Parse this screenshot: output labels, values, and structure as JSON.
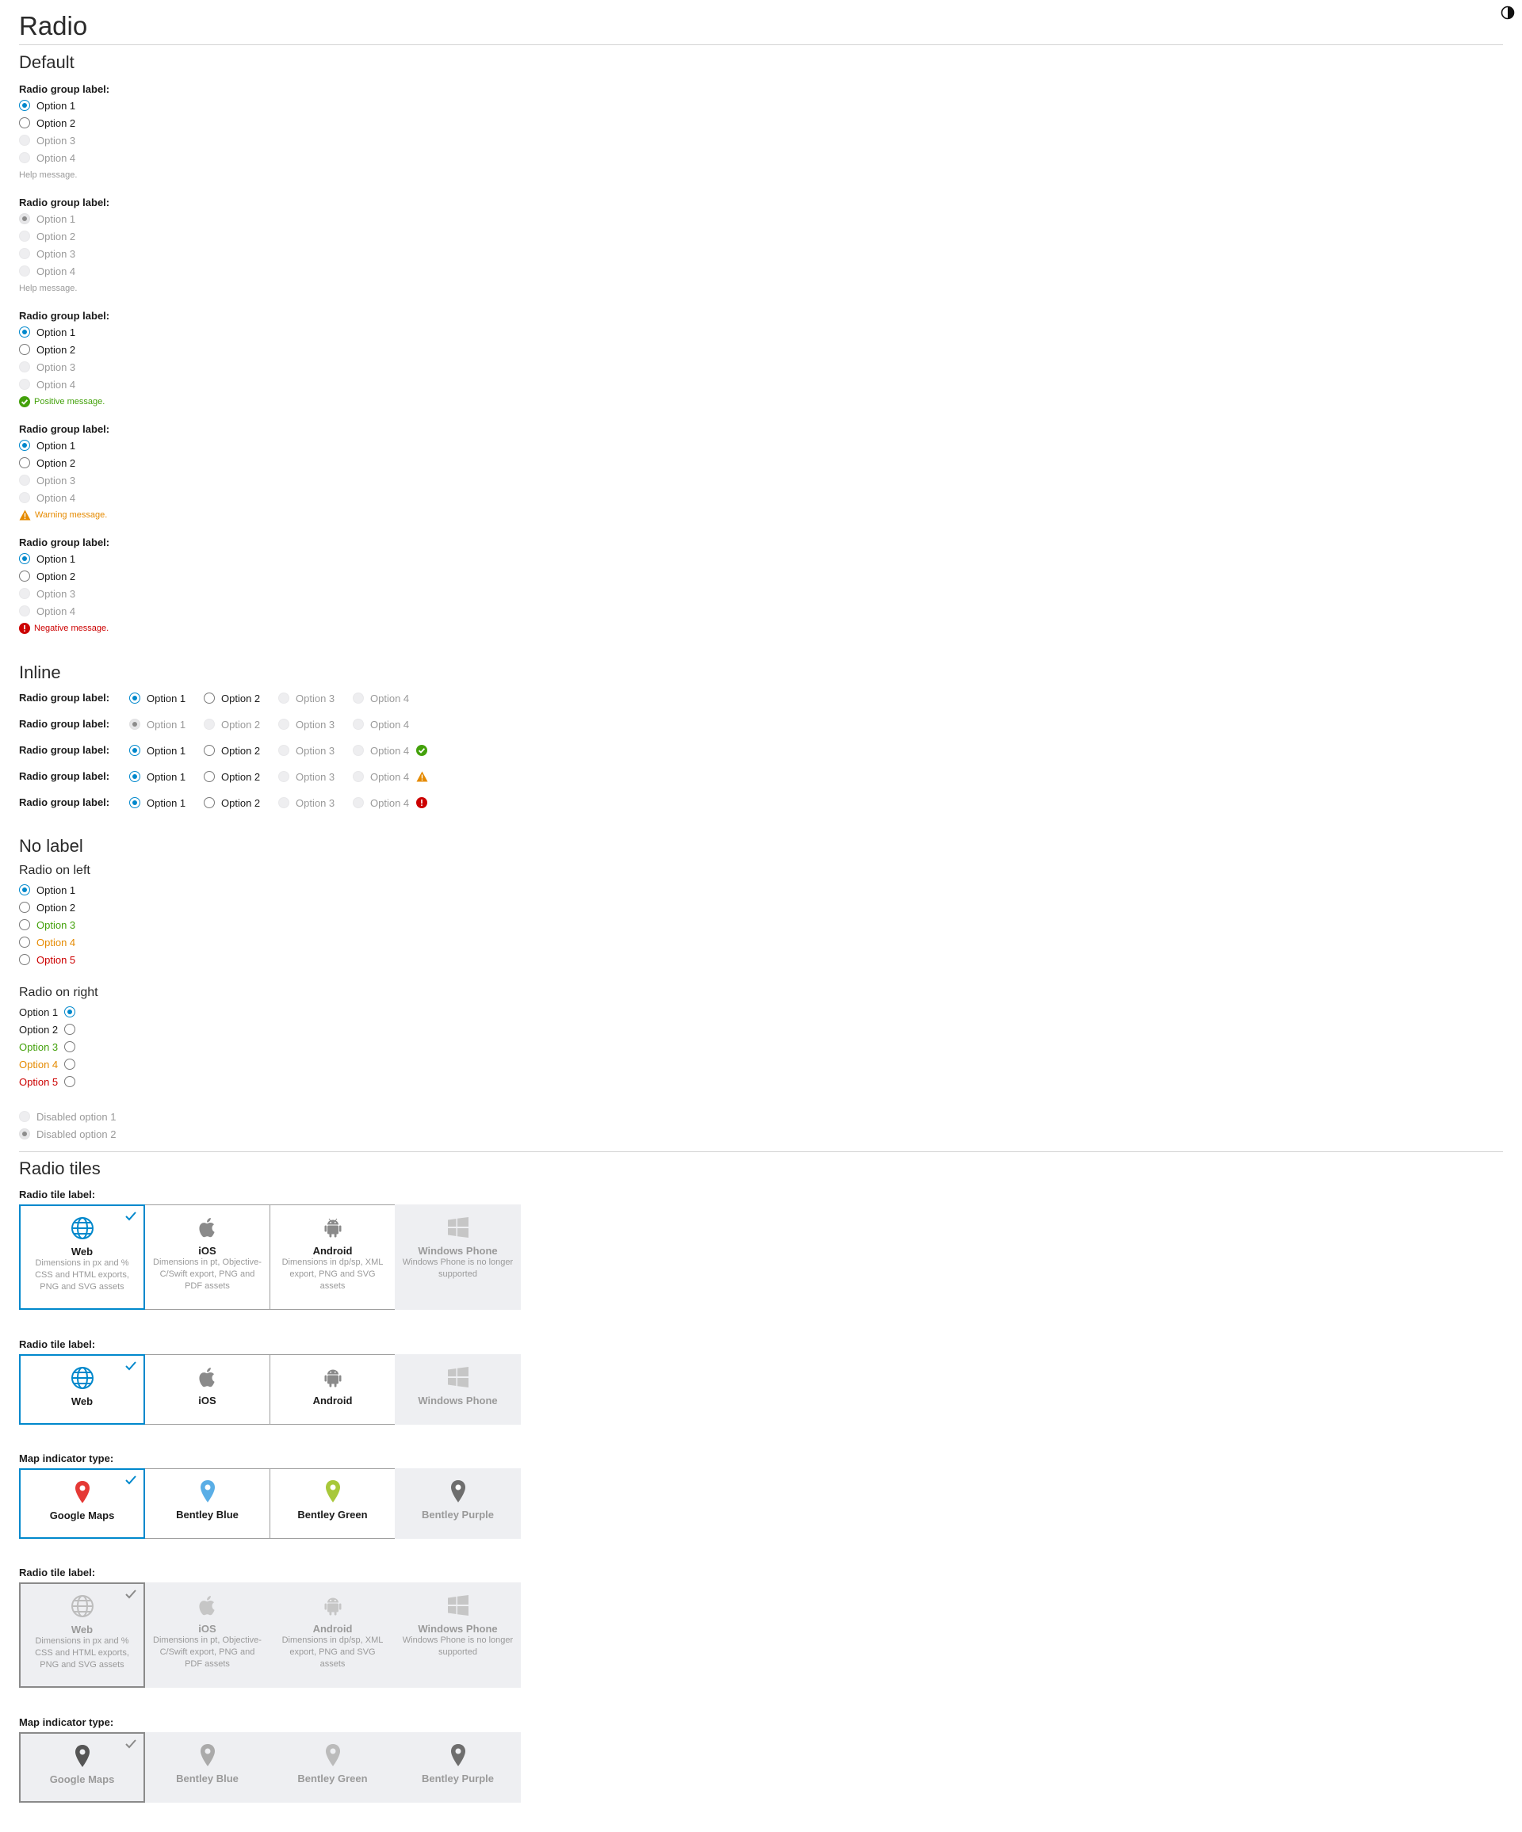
{
  "page": {
    "title": "Radio"
  },
  "sections": {
    "default": "Default",
    "inline": "Inline",
    "no_label": "No label",
    "radio_tiles": "Radio tiles"
  },
  "default_groups": [
    {
      "label": "Radio group label:",
      "options": [
        "Option 1",
        "Option 2",
        "Option 3",
        "Option 4"
      ],
      "message": "Help message."
    },
    {
      "label": "Radio group label:",
      "options": [
        "Option 1",
        "Option 2",
        "Option 3",
        "Option 4"
      ],
      "message": "Help message."
    },
    {
      "label": "Radio group label:",
      "options": [
        "Option 1",
        "Option 2",
        "Option 3",
        "Option 4"
      ],
      "message": "Positive message."
    },
    {
      "label": "Radio group label:",
      "options": [
        "Option 1",
        "Option 2",
        "Option 3",
        "Option 4"
      ],
      "message": "Warning message."
    },
    {
      "label": "Radio group label:",
      "options": [
        "Option 1",
        "Option 2",
        "Option 3",
        "Option 4"
      ],
      "message": "Negative message."
    }
  ],
  "inline_rows": [
    {
      "label": "Radio group label:",
      "options": [
        "Option 1",
        "Option 2",
        "Option 3",
        "Option 4"
      ]
    },
    {
      "label": "Radio group label:",
      "options": [
        "Option 1",
        "Option 2",
        "Option 3",
        "Option 4"
      ]
    },
    {
      "label": "Radio group label:",
      "options": [
        "Option 1",
        "Option 2",
        "Option 3",
        "Option 4"
      ]
    },
    {
      "label": "Radio group label:",
      "options": [
        "Option 1",
        "Option 2",
        "Option 3",
        "Option 4"
      ]
    },
    {
      "label": "Radio group label:",
      "options": [
        "Option 1",
        "Option 2",
        "Option 3",
        "Option 4"
      ]
    }
  ],
  "no_label": {
    "left_heading": "Radio on left",
    "left_options": [
      "Option 1",
      "Option 2",
      "Option 3",
      "Option 4",
      "Option 5"
    ],
    "right_heading": "Radio on right",
    "right_options": [
      "Option 1",
      "Option 2",
      "Option 3",
      "Option 4",
      "Option 5"
    ],
    "disabled_options": [
      "Disabled option 1",
      "Disabled option 2"
    ]
  },
  "tiles": {
    "tile_label": "Radio tile label:",
    "map_label": "Map indicator type:",
    "platforms": [
      {
        "name": "Web",
        "desc": "Dimensions in px and % CSS and HTML exports, PNG and SVG assets",
        "icon": "globe-icon"
      },
      {
        "name": "iOS",
        "desc": "Dimensions in pt, Objective-C/Swift export, PNG and PDF assets",
        "icon": "apple-icon"
      },
      {
        "name": "Android",
        "desc": "Dimensions in dp/sp, XML export, PNG and SVG assets",
        "icon": "android-icon"
      },
      {
        "name": "Windows Phone",
        "desc": "Windows Phone is no longer supported",
        "icon": "windows-icon"
      }
    ],
    "maps": [
      {
        "name": "Google Maps",
        "icon": "map-pin-icon"
      },
      {
        "name": "Bentley Blue",
        "icon": "map-pin-icon"
      },
      {
        "name": "Bentley Green",
        "icon": "map-pin-icon"
      },
      {
        "name": "Bentley Purple",
        "icon": "map-pin-icon"
      }
    ]
  },
  "colors": {
    "accent": "#0088cc",
    "positive": "#43a10b",
    "warning": "#e58a00",
    "negative": "#cc0000",
    "pin_google": "#e53935",
    "pin_blue": "#5aaee6",
    "pin_green": "#a8c83a",
    "pin_purple": "#6e6e6e"
  }
}
